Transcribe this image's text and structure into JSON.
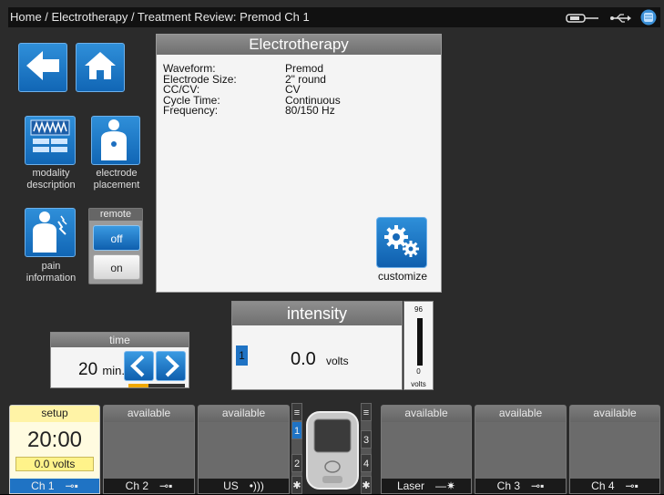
{
  "breadcrumb": "Home / Electrotherapy / Treatment Review: Premod Ch 1",
  "status_icons": [
    "probe-icon",
    "usb-icon",
    "database-icon"
  ],
  "nav": {
    "back_icon": "back-arrow-icon",
    "home_icon": "home-icon"
  },
  "tiles": {
    "modality_label_1": "modality",
    "modality_label_2": "description",
    "electrode_label_1": "electrode",
    "electrode_label_2": "placement",
    "pain_label_1": "pain",
    "pain_label_2": "information"
  },
  "remote": {
    "title": "remote",
    "off": "off",
    "on": "on",
    "selected": "off"
  },
  "panel": {
    "title": "Electrotherapy",
    "params": [
      {
        "key": "Waveform:",
        "value": "Premod"
      },
      {
        "key": "Electrode Size:",
        "value": "2\" round"
      },
      {
        "key": "CC/CV:",
        "value": "CV"
      },
      {
        "key": "Cycle Time:",
        "value": "Continuous"
      },
      {
        "key": "Frequency:",
        "value": "80/150 Hz"
      }
    ],
    "customize_label": "customize"
  },
  "time": {
    "title": "time",
    "value": "20",
    "unit": "min.",
    "progress": 0.35
  },
  "intensity": {
    "title": "intensity",
    "channel": "1",
    "value": "0.0",
    "unit": "volts",
    "gauge_max": "96",
    "gauge_min": "0",
    "gauge_unit": "volts"
  },
  "channels": [
    {
      "state": "setup",
      "clock": "20:00",
      "volts": "0.0 volts",
      "name": "Ch 1"
    },
    {
      "state": "available",
      "name": "Ch 2"
    },
    {
      "state": "available",
      "name": "US"
    },
    {
      "state": "available",
      "name": "Laser"
    },
    {
      "state": "available",
      "name": "Ch 3"
    },
    {
      "state": "available",
      "name": "Ch 4"
    }
  ],
  "device_ports": [
    "1",
    "2",
    "3",
    "4"
  ],
  "colors": {
    "accent_blue": "#1f73c4",
    "setup_yellow": "#fff3a6",
    "timer_progress": "#f0a800"
  }
}
